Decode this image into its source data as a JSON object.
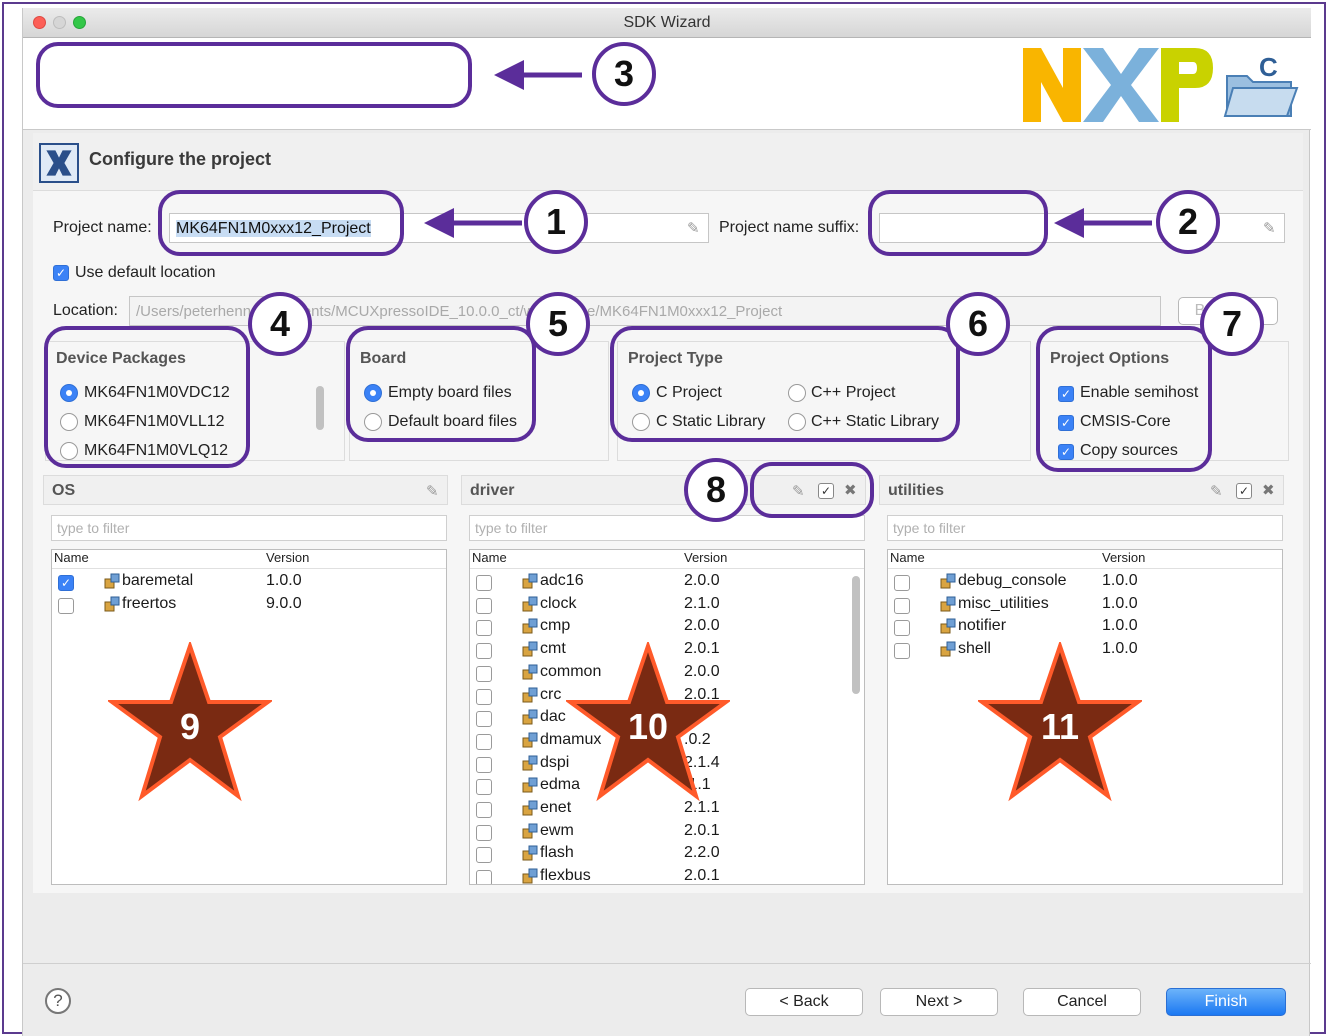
{
  "window": {
    "title": "SDK Wizard"
  },
  "header": {
    "title": "Configure the project"
  },
  "project": {
    "name_label": "Project name:",
    "name_value": "MK64FN1M0xxx12_Project",
    "suffix_label": "Project name suffix:",
    "suffix_value": "",
    "use_default_location_label": "Use default location",
    "use_default_location_checked": true,
    "location_label": "Location:",
    "location_value": "/Users/peterhenn/Documents/MCUXpressoIDE_10.0.0_ct/workspace/MK64FN1M0xxx12_Project",
    "browse_label": "Browse..."
  },
  "device_packages": {
    "title": "Device Packages",
    "options": [
      "MK64FN1M0VDC12",
      "MK64FN1M0VLL12",
      "MK64FN1M0VLQ12"
    ],
    "selected": "MK64FN1M0VDC12"
  },
  "board": {
    "title": "Board",
    "options": [
      "Empty board files",
      "Default board files"
    ],
    "selected": "Empty board files"
  },
  "project_type": {
    "title": "Project Type",
    "options": [
      "C Project",
      "C++ Project",
      "C Static Library",
      "C++ Static Library"
    ],
    "selected": "C Project"
  },
  "project_options": {
    "title": "Project Options",
    "items": [
      {
        "label": "Enable semihost",
        "checked": true
      },
      {
        "label": "CMSIS-Core",
        "checked": true
      },
      {
        "label": "Copy sources",
        "checked": true
      }
    ]
  },
  "panels": {
    "os": {
      "title": "OS",
      "filter_placeholder": "type to filter",
      "col_name": "Name",
      "col_version": "Version",
      "rows": [
        {
          "name": "baremetal",
          "version": "1.0.0",
          "checked": true
        },
        {
          "name": "freertos",
          "version": "9.0.0",
          "checked": false
        }
      ]
    },
    "driver": {
      "title": "driver",
      "filter_placeholder": "type to filter",
      "col_name": "Name",
      "col_version": "Version",
      "rows": [
        {
          "name": "adc16",
          "version": "2.0.0"
        },
        {
          "name": "clock",
          "version": "2.1.0"
        },
        {
          "name": "cmp",
          "version": "2.0.0"
        },
        {
          "name": "cmt",
          "version": "2.0.1"
        },
        {
          "name": "common",
          "version": "2.0.0"
        },
        {
          "name": "crc",
          "version": "2.0.1"
        },
        {
          "name": "dac",
          "version": ""
        },
        {
          "name": "dmamux",
          "version": ".0.2"
        },
        {
          "name": "dspi",
          "version": "2.1.4"
        },
        {
          "name": "edma",
          "version": ".1.1"
        },
        {
          "name": "enet",
          "version": "2.1.1"
        },
        {
          "name": "ewm",
          "version": "2.0.1"
        },
        {
          "name": "flash",
          "version": "2.2.0"
        },
        {
          "name": "flexbus",
          "version": "2.0.1"
        }
      ]
    },
    "utilities": {
      "title": "utilities",
      "filter_placeholder": "type to filter",
      "col_name": "Name",
      "col_version": "Version",
      "rows": [
        {
          "name": "debug_console",
          "version": "1.0.0"
        },
        {
          "name": "misc_utilities",
          "version": "1.0.0"
        },
        {
          "name": "notifier",
          "version": "1.0.0"
        },
        {
          "name": "shell",
          "version": "1.0.0"
        }
      ]
    }
  },
  "footer": {
    "help": "?",
    "back": "< Back",
    "next": "Next >",
    "cancel": "Cancel",
    "finish": "Finish"
  },
  "annotations": {
    "numbers": [
      "1",
      "2",
      "3",
      "4",
      "5",
      "6",
      "7",
      "8",
      "9",
      "10",
      "11"
    ],
    "outline_color": "#5b2d9a",
    "star_color": "#7a2a12",
    "star_border": "#ff5a2a"
  },
  "logo_text": "NXP"
}
